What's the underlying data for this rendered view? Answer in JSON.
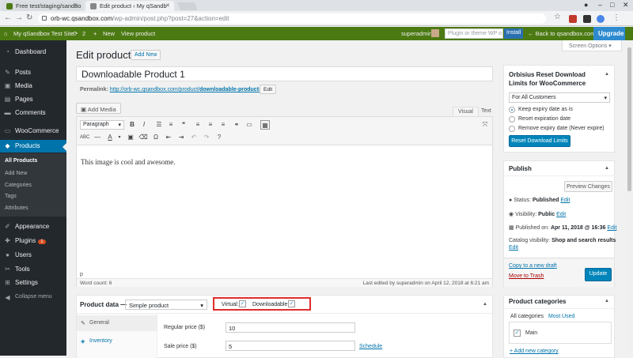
{
  "browser": {
    "tabs": [
      {
        "title": "Free test/staging/sandbo",
        "active": false
      },
      {
        "title": "Edit product ‹ My qSandb",
        "active": true
      }
    ],
    "url_host": "orb-wc.qsandbox.com",
    "url_path": "/wp-admin/post.php?post=27&action=edit",
    "window_controls": [
      "–",
      "□",
      "✕"
    ]
  },
  "adminbar": {
    "site_name": "My qSandbox Test Site",
    "updates": "2",
    "new_label": "New",
    "view_label": "View product",
    "user": "superadmin",
    "search_placeholder": "Plugin or theme WP o",
    "install_label": "Install",
    "back_label": "← Back to qsandbox.com",
    "upgrade_label": "Upgrade"
  },
  "sidebar": {
    "items": [
      {
        "label": "Dashboard",
        "icon": "dashboard-icon"
      },
      {
        "label": "Posts",
        "icon": "pin-icon"
      },
      {
        "label": "Media",
        "icon": "media-icon"
      },
      {
        "label": "Pages",
        "icon": "pages-icon"
      },
      {
        "label": "Comments",
        "icon": "comments-icon"
      },
      {
        "label": "WooCommerce",
        "icon": "woocommerce-icon"
      },
      {
        "label": "Products",
        "icon": "products-icon"
      },
      {
        "label": "Appearance",
        "icon": "appearance-icon"
      },
      {
        "label": "Plugins",
        "icon": "plugins-icon",
        "badge": "1"
      },
      {
        "label": "Users",
        "icon": "users-icon"
      },
      {
        "label": "Tools",
        "icon": "tools-icon"
      },
      {
        "label": "Settings",
        "icon": "settings-icon"
      },
      {
        "label": "Collapse menu",
        "icon": "collapse-icon"
      }
    ],
    "submenu": [
      "All Products",
      "Add New",
      "Categories",
      "Tags",
      "Attributes"
    ]
  },
  "main": {
    "page_title": "Edit product",
    "add_new": "Add New",
    "screen_options": "Screen Options ▾",
    "post_title": "Downloadable Product 1",
    "permalink_label": "Permalink:",
    "permalink_base": "http://orb-wc.qsandbox.com/product/",
    "permalink_slug": "downloadable-product-1",
    "permalink_end": "/",
    "edit_slug": "Edit",
    "add_media": "Add Media",
    "editor_tabs": [
      "Visual",
      "Text"
    ],
    "format_select": "Paragraph",
    "content": "This image is cool and awesome.",
    "path": "p",
    "word_count": "Word count: 6",
    "last_edited": "Last edited by superadmin on April 12, 2018 at 6:21 am"
  },
  "product_data": {
    "title": "Product data —",
    "type": "Simple product",
    "virtual_label": "Virtual:",
    "downloadable_label": "Downloadable:",
    "virtual_checked": true,
    "downloadable_checked": true,
    "tabs": [
      {
        "label": "General",
        "icon": "wrench-icon"
      },
      {
        "label": "Inventory",
        "icon": "inventory-icon"
      }
    ],
    "regular_price_label": "Regular price ($)",
    "regular_price": "10",
    "sale_price_label": "Sale price ($)",
    "sale_price": "5",
    "schedule": "Schedule"
  },
  "reset_box": {
    "title": "Orbisius Reset Download Limits for WooCommerce",
    "select": "For All Customers",
    "options": [
      "Keep expiry date as is",
      "Reset expiration date",
      "Remove expiry date (Never expire)"
    ],
    "selected": 0,
    "button": "Reset Download Limits"
  },
  "publish": {
    "title": "Publish",
    "preview": "Preview Changes",
    "status_label": "Status:",
    "status": "Published",
    "visibility_label": "Visibility:",
    "visibility": "Public",
    "published_label": "Published on:",
    "published": "Apr 11, 2018 @ 16:36",
    "catalog_label": "Catalog visibility:",
    "catalog": "Shop and search results",
    "edit": "Edit",
    "copy_draft": "Copy to a new draft",
    "trash": "Move to Trash",
    "update": "Update"
  },
  "categories": {
    "title": "Product categories",
    "tabs": [
      "All categories",
      "Most Used"
    ],
    "items": [
      {
        "label": "Main",
        "checked": true
      }
    ],
    "add_new": "+ Add new category"
  },
  "colors": {
    "adminbar": "#4c7a12",
    "sidebar": "#23282d",
    "accent": "#0073aa",
    "highlight_box": "#e02d2d"
  }
}
